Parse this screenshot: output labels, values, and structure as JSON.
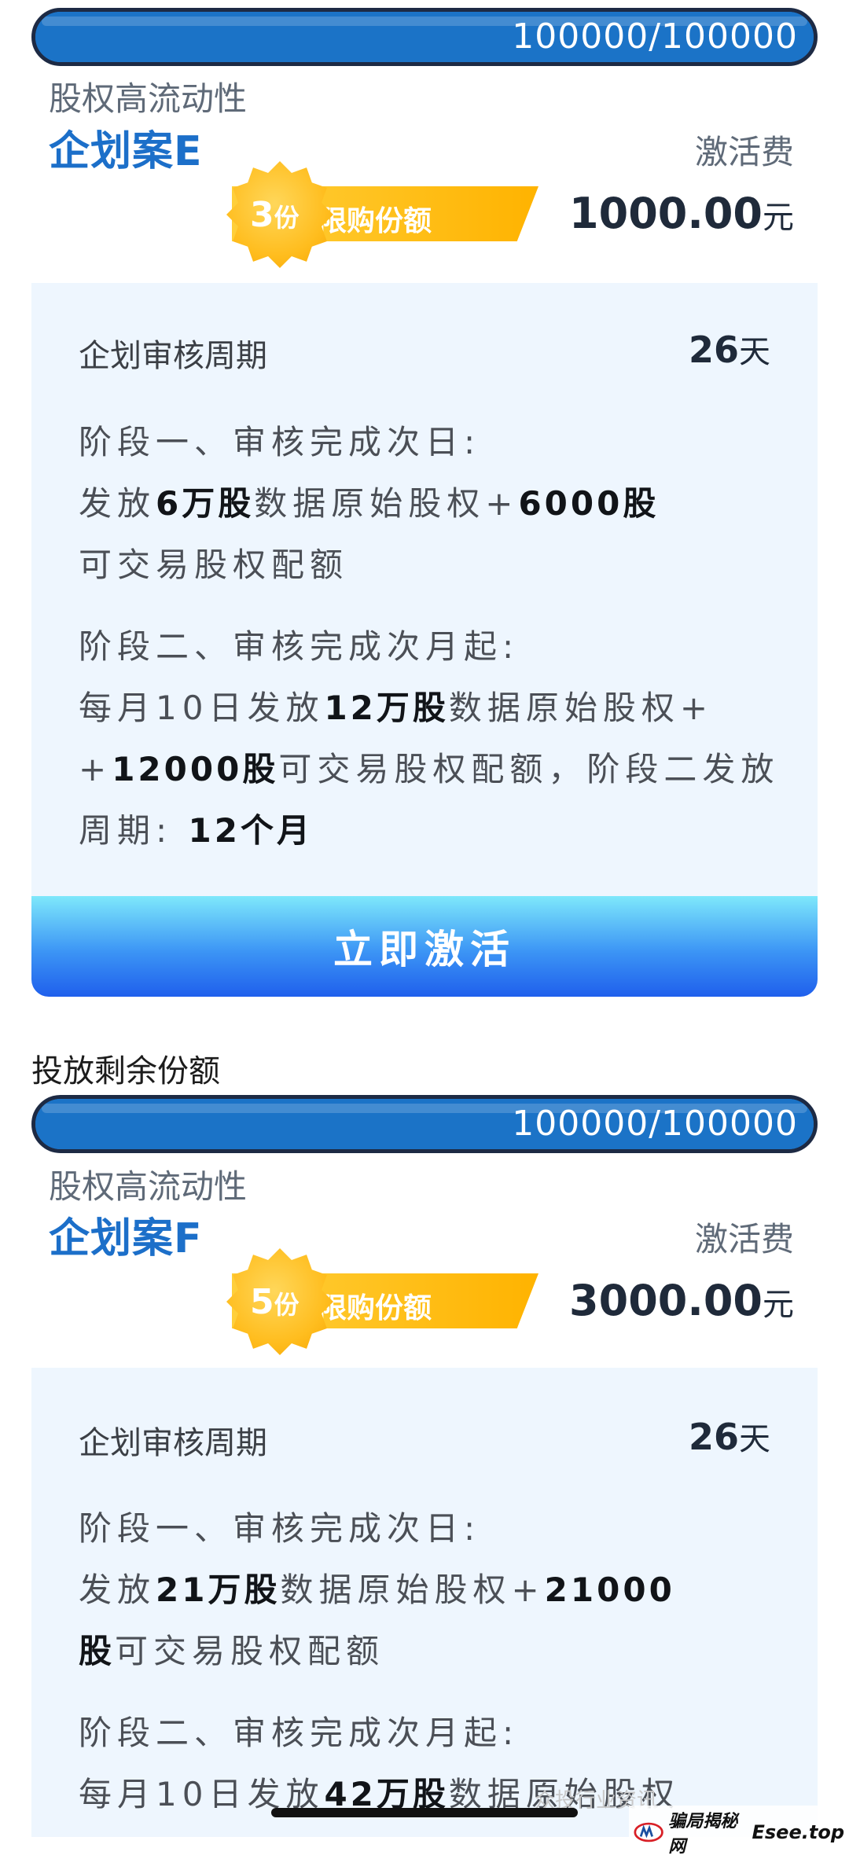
{
  "quota_section_title": "投放剩余份额",
  "plans": [
    {
      "progress_text": "100000/100000",
      "progress_fraction": 1.0,
      "category": "股权高流动性",
      "name": "企划案E",
      "quota_count": "3",
      "quota_unit": "份",
      "quota_label": "限购份额",
      "fee_label": "激活费",
      "fee_amount": "1000.00",
      "fee_unit": "元",
      "cycle_label": "企划审核周期",
      "cycle_value": "26",
      "cycle_unit": "天",
      "stage1": {
        "title": "阶段一、审核完成次日:",
        "t1": "发放",
        "b1": "6万股",
        "t2": "数据原始股权+",
        "b2": "6000股",
        "t3": "可交易股权配额"
      },
      "stage2": {
        "title": "阶段二、审核完成次月起:",
        "t1": "每月10日发放",
        "b1": "12万股",
        "t2": "数据原始股权+",
        "b2": "12000股",
        "t3": "可交易股权配额，阶段二发放周期:",
        "b3": "12个月"
      },
      "button_label": "立即激活"
    },
    {
      "progress_text": "100000/100000",
      "progress_fraction": 1.0,
      "category": "股权高流动性",
      "name": "企划案F",
      "quota_count": "5",
      "quota_unit": "份",
      "quota_label": "限购份额",
      "fee_label": "激活费",
      "fee_amount": "3000.00",
      "fee_unit": "元",
      "cycle_label": "企划审核周期",
      "cycle_value": "26",
      "cycle_unit": "天",
      "stage1": {
        "title": "阶段一、审核完成次日:",
        "t1": "发放",
        "b1": "21万股",
        "t2": "数据原始股权+",
        "b2": "21000",
        "b3": "股",
        "t3": "可交易股权配额"
      },
      "stage2": {
        "title": "阶段二、审核完成次月起:",
        "t1": "每月10日发放",
        "b1": "42万股",
        "t2": "数据原始股权"
      }
    }
  ],
  "watermark": "众投行业资讯",
  "site_logo": "骗局揭秘网",
  "site_domain": "Esee.top",
  "colors": {
    "progress": "#1e80d9",
    "plan_name": "#1c6fc9",
    "badge": "#ffbd1e",
    "button": "#3c95f5",
    "panel": "#eef6fe"
  }
}
